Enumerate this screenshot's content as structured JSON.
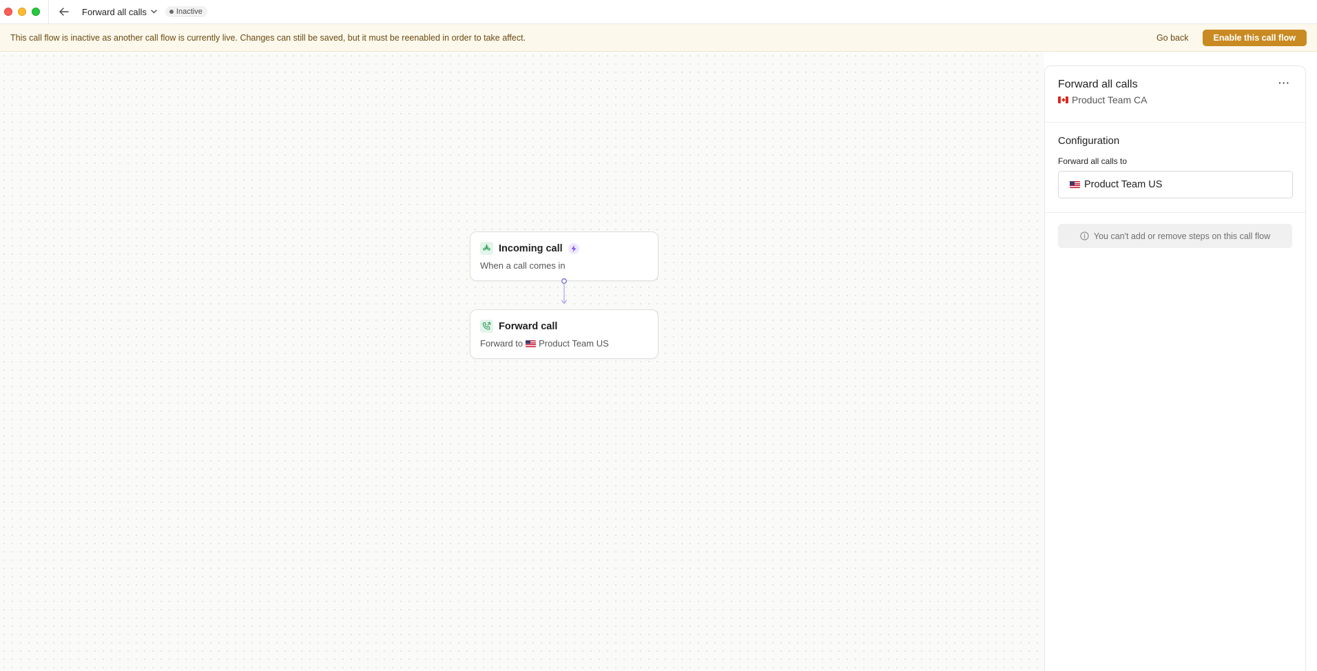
{
  "titlebar": {
    "flow_name": "Forward all calls",
    "status": "Inactive"
  },
  "banner": {
    "message": "This call flow is inactive as another call flow is currently live. Changes can still be saved, but it must be reenabled in order to take affect.",
    "go_back_label": "Go back",
    "enable_label": "Enable this call flow"
  },
  "nodes": {
    "incoming": {
      "title": "Incoming call",
      "subtitle": "When a call comes in"
    },
    "forward": {
      "title": "Forward call",
      "subtitle_prefix": "Forward to",
      "target": "Product Team US"
    }
  },
  "panel": {
    "title": "Forward all calls",
    "subtitle": "Product Team CA",
    "more_label": "···",
    "config_heading": "Configuration",
    "field_label": "Forward all calls to",
    "field_value": "Product Team US",
    "notice": "You can't add or remove steps on this call flow"
  },
  "colors": {
    "accent": "#c98a22",
    "banner_bg": "#fcf8ec",
    "banner_text": "#6b4a12",
    "node_icon_bg": "#e3f4ea",
    "node_icon_fg": "#2f9d5a",
    "bolt_color": "#7c4dff",
    "connector": "#8b84e0"
  },
  "icons": {
    "back": "arrow-left-icon",
    "dropdown": "chevron-down-icon",
    "incoming": "incoming-call-icon",
    "bolt": "lightning-bolt-icon",
    "forward": "phone-forward-icon",
    "more": "more-horizontal-icon",
    "info": "info-icon"
  }
}
